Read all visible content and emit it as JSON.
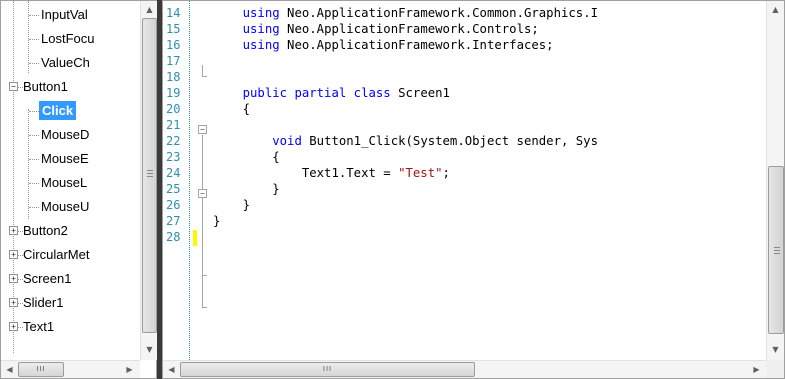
{
  "tree": {
    "nodes": [
      {
        "label": "InputVal",
        "level": 2,
        "expander": null
      },
      {
        "label": "LostFocu",
        "level": 2,
        "expander": null
      },
      {
        "label": "ValueCh",
        "level": 2,
        "expander": null
      },
      {
        "label": "Button1",
        "level": 1,
        "expander": "−"
      },
      {
        "label": "Click",
        "level": 2,
        "expander": null,
        "selected": true
      },
      {
        "label": "MouseD",
        "level": 2,
        "expander": null
      },
      {
        "label": "MouseE",
        "level": 2,
        "expander": null
      },
      {
        "label": "MouseL",
        "level": 2,
        "expander": null
      },
      {
        "label": "MouseU",
        "level": 2,
        "expander": null
      },
      {
        "label": "Button2",
        "level": 1,
        "expander": "+"
      },
      {
        "label": "CircularMet",
        "level": 1,
        "expander": "+"
      },
      {
        "label": "Screen1",
        "level": 1,
        "expander": "+"
      },
      {
        "label": "Slider1",
        "level": 1,
        "expander": "+"
      },
      {
        "label": "Text1",
        "level": 1,
        "expander": "+"
      }
    ],
    "scroll_up_icon": "▲",
    "scroll_down_icon": "▼",
    "scroll_left_icon": "◀",
    "scroll_right_icon": "▶",
    "hthumb_grip": "III"
  },
  "editor": {
    "line_numbers": [
      "14",
      "15",
      "16",
      "17",
      "18",
      "19",
      "20",
      "21",
      "22",
      "23",
      "24",
      "25",
      "26",
      "27",
      "28"
    ],
    "lines": [
      [
        {
          "t": "    "
        },
        {
          "t": "using",
          "c": "kw"
        },
        {
          "t": " Neo.ApplicationFramework.Common.Graphics.I"
        }
      ],
      [
        {
          "t": "    "
        },
        {
          "t": "using",
          "c": "kw"
        },
        {
          "t": " Neo.ApplicationFramework.Controls;"
        }
      ],
      [
        {
          "t": "    "
        },
        {
          "t": "using",
          "c": "kw"
        },
        {
          "t": " Neo.ApplicationFramework.Interfaces;"
        }
      ],
      [],
      [],
      [
        {
          "t": "    "
        },
        {
          "t": "public partial class",
          "c": "kw"
        },
        {
          "t": " Screen1"
        }
      ],
      [
        {
          "t": "    {"
        }
      ],
      [],
      [
        {
          "t": "        "
        },
        {
          "t": "void",
          "c": "kw"
        },
        {
          "t": " Button1_Click(System.Object sender, Sys"
        }
      ],
      [
        {
          "t": "        {"
        }
      ],
      [
        {
          "t": "            Text1.Text = "
        },
        {
          "t": "\"Test\"",
          "c": "str"
        },
        {
          "t": ";"
        }
      ],
      [
        {
          "t": "        }"
        }
      ],
      [
        {
          "t": "    }"
        }
      ],
      [
        {
          "t": "}"
        }
      ],
      []
    ],
    "hthumb_grip": "III"
  },
  "colors": {
    "keyword": "#0000ff",
    "string": "#a31515",
    "line_number": "#2b91af",
    "selection": "#3399ff",
    "change_marker": "#fff700"
  }
}
